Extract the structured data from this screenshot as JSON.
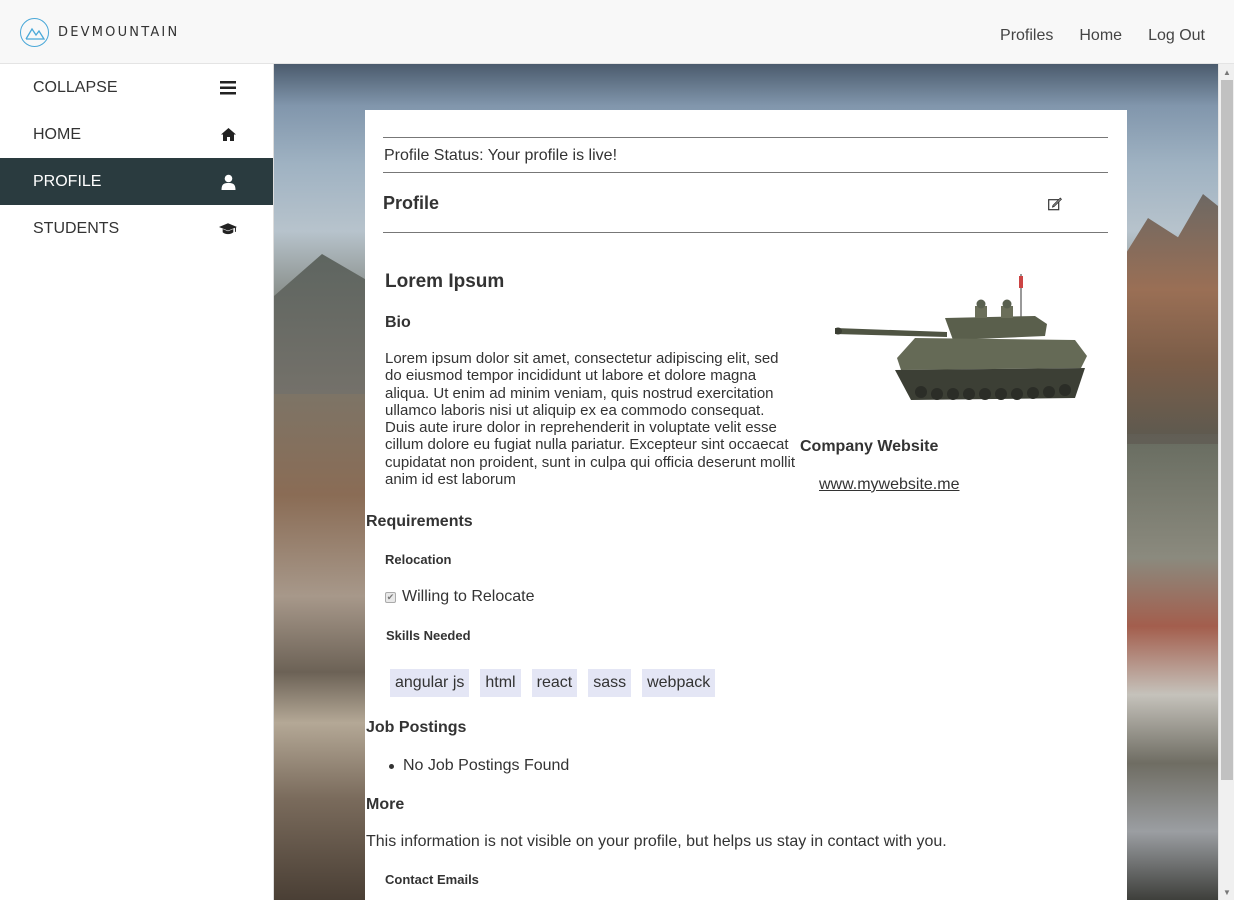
{
  "header": {
    "brand": "DEVMOUNTAIN",
    "nav": [
      "Profiles",
      "Home",
      "Log Out"
    ]
  },
  "sidebar": {
    "items": [
      {
        "label": "COLLAPSE",
        "icon": "bars-icon",
        "active": false
      },
      {
        "label": "HOME",
        "icon": "home-icon",
        "active": false
      },
      {
        "label": "PROFILE",
        "icon": "user-icon",
        "active": true
      },
      {
        "label": "STUDENTS",
        "icon": "graduation-cap-icon",
        "active": false
      }
    ]
  },
  "profile": {
    "status": "Profile Status: Your profile is live!",
    "title": "Profile",
    "name": "Lorem Ipsum",
    "bio_label": "Bio",
    "bio": "Lorem ipsum dolor sit amet, consectetur adipiscing elit, sed do eiusmod tempor incididunt ut labore et dolore magna aliqua. Ut enim ad minim veniam, quis nostrud exercitation ullamco laboris nisi ut aliquip ex ea commodo consequat. Duis aute irure dolor in reprehenderit in voluptate velit esse cillum dolore eu fugiat nulla pariatur. Excepteur sint occaecat cupidatat non proident, sunt in culpa qui officia deserunt mollit anim id est laborum",
    "website_label": "Company Website",
    "website": "www.mywebsite.me",
    "requirements_label": "Requirements",
    "relocation_label": "Relocation",
    "relocation_option": "Willing to Relocate",
    "relocation_checked": true,
    "skills_label": "Skills Needed",
    "skills": [
      "angular js",
      "html",
      "react",
      "sass",
      "webpack"
    ],
    "jobs_label": "Job Postings",
    "jobs": [
      "No Job Postings Found"
    ],
    "more_label": "More",
    "more_text": "This information is not visible on your profile, but helps us stay in contact with you.",
    "contact_label": "Contact Emails"
  },
  "colors": {
    "sidebar_active": "#2a3b3f",
    "brand_accent": "#4aa8d8",
    "skill_tag": "#e4e6f5"
  }
}
